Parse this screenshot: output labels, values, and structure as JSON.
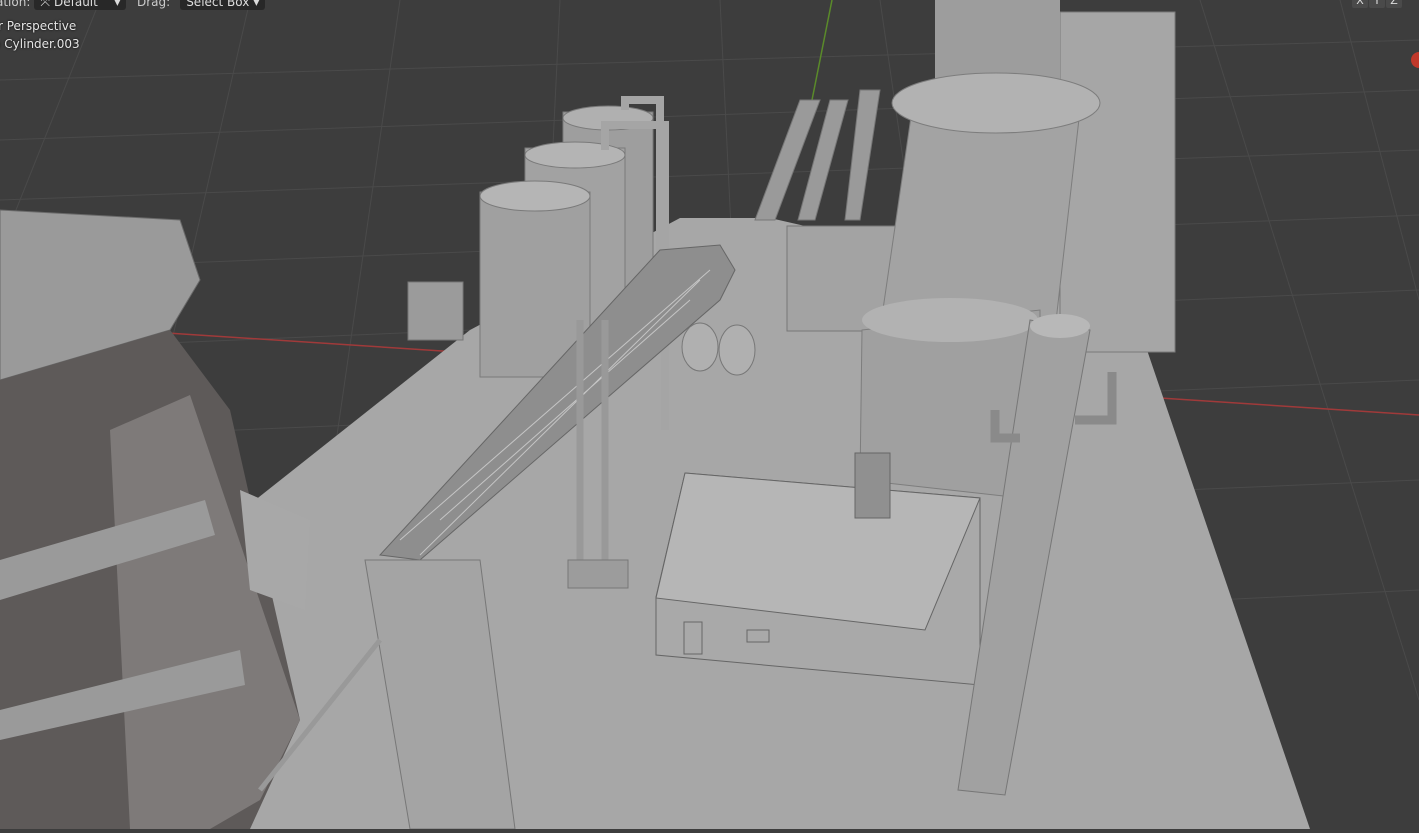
{
  "header": {
    "orientation_label": "ation:",
    "orientation_value": "Default",
    "drag_label": "Drag:",
    "drag_value": "Select Box"
  },
  "viewport": {
    "view_name": "r Perspective",
    "active_object": "Cylinder.003"
  },
  "axis_buttons": [
    "X",
    "Y",
    "Z"
  ],
  "colors": {
    "background": "#3d3d3d",
    "grid": "#474747",
    "x_axis": "#a03a3a",
    "y_axis": "#5a8a2a",
    "model": "#a9a9a9"
  }
}
